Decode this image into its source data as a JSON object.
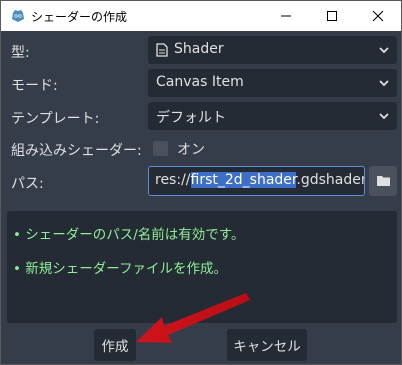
{
  "window": {
    "title": "シェーダーの作成"
  },
  "form": {
    "type_label": "型:",
    "type_value": "Shader",
    "mode_label": "モード:",
    "mode_value": "Canvas Item",
    "template_label": "テンプレート:",
    "template_value": "デフォルト",
    "builtin_label": "組み込みシェーダー:",
    "builtin_checked": false,
    "builtin_value": "オン",
    "path_label": "パス:",
    "path_prefix": "res://",
    "path_selected": "first_2d_shader",
    "path_suffix": ".gdshader"
  },
  "messages": [
    "• シェーダーのパス/名前は有効です。",
    "• 新規シェーダーファイルを作成。"
  ],
  "buttons": {
    "create": "作成",
    "cancel": "キャンセル"
  },
  "colors": {
    "background": "#363d4a",
    "field": "#252b34",
    "message": "#8eef97",
    "focus": "#5c8dd6",
    "annotation_arrow": "#d0141a"
  },
  "icons": {
    "app": "godot-icon",
    "shader": "shader-file-icon",
    "folder": "folder-icon",
    "annotation": "red-arrow"
  }
}
